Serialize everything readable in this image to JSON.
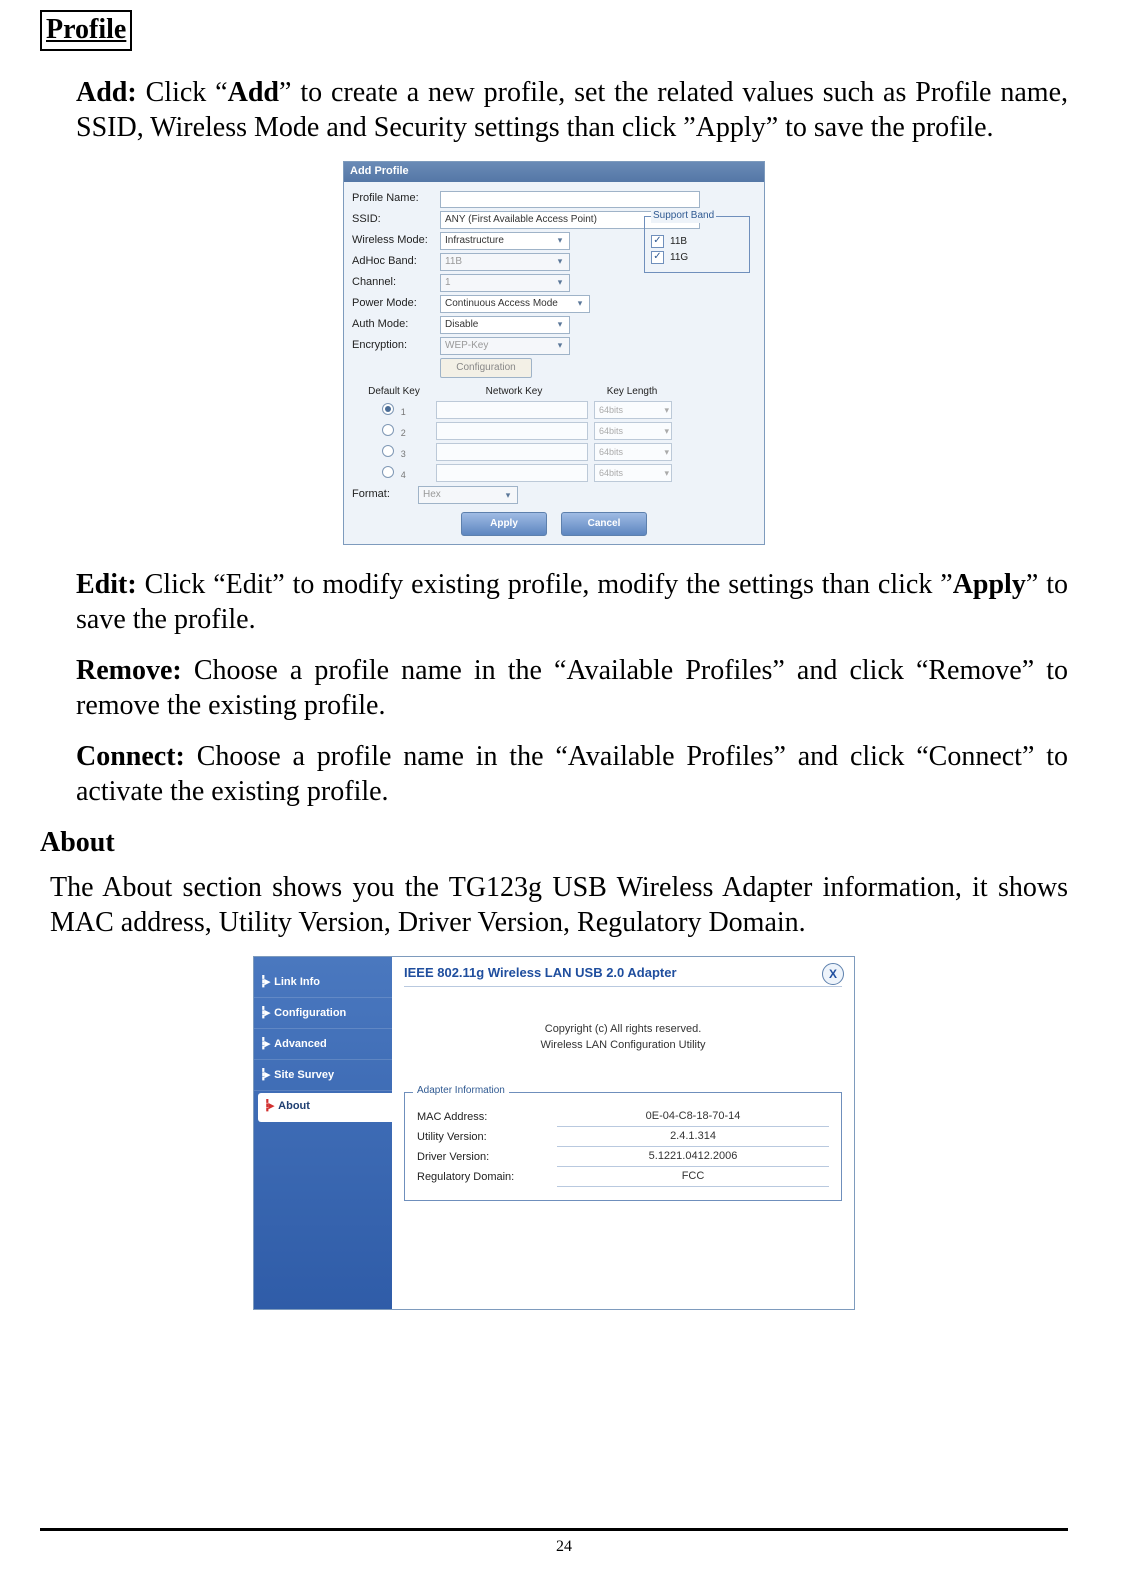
{
  "doc": {
    "section1_title": "Profile",
    "add_label": "Add:",
    "add_text_a": " Click “",
    "add_bold": "Add",
    "add_text_b": "” to create a new profile, set the related values such as Profile name, SSID, Wireless Mode and Security settings than click ”Apply” to save the profile.",
    "edit_label": "Edit:",
    "edit_text_a": " Click “Edit” to modify existing profile, modify the settings than click ”",
    "edit_bold": "Apply",
    "edit_text_b": "” to save the profile.",
    "remove_label": "Remove:",
    "remove_text": " Choose a profile name in the “Available Profiles” and click “Remove” to remove the existing profile.",
    "connect_label": "Connect:",
    "connect_text": " Choose a profile name in the “Available Profiles” and click “Connect” to activate the existing profile.",
    "section2_title": "About",
    "about_para": "The About section shows you the TG123g USB Wireless Adapter information, it shows MAC address, Utility Version, Driver Version, Regulatory Domain.",
    "page_number": "24"
  },
  "dialog": {
    "title": "Add Profile",
    "labels": {
      "profile_name": "Profile Name:",
      "ssid": "SSID:",
      "wireless_mode": "Wireless Mode:",
      "adhoc_band": "AdHoc Band:",
      "channel": "Channel:",
      "power_mode": "Power Mode:",
      "auth_mode": "Auth Mode:",
      "encryption": "Encryption:",
      "format": "Format:"
    },
    "values": {
      "ssid": "ANY (First Available Access Point)",
      "wireless_mode": "Infrastructure",
      "adhoc_band": "11B",
      "channel": "1",
      "power_mode": "Continuous Access Mode",
      "auth_mode": "Disable",
      "encryption": "WEP-Key",
      "format": "Hex"
    },
    "support_band": {
      "legend": "Support Band",
      "b": "11B",
      "g": "11G"
    },
    "cfg_btn": "Configuration",
    "key_headers": {
      "def": "Default Key",
      "net": "Network Key",
      "len": "Key Length"
    },
    "key_len_value": "64bits",
    "apply": "Apply",
    "cancel": "Cancel"
  },
  "about": {
    "sidebar": {
      "link_info": "Link Info",
      "configuration": "Configuration",
      "advanced": "Advanced",
      "site_survey": "Site Survey",
      "about": "About"
    },
    "title": "IEEE 802.11g Wireless LAN USB 2.0 Adapter",
    "copyright": "Copyright (c)  All rights reserved.",
    "prod_line": "Wireless LAN Configuration Utility",
    "adapter_legend": "Adapter Information",
    "rows": {
      "mac_l": "MAC Address:",
      "mac_v": "0E-04-C8-18-70-14",
      "util_l": "Utility Version:",
      "util_v": "2.4.1.314",
      "drv_l": "Driver Version:",
      "drv_v": "5.1221.0412.2006",
      "reg_l": "Regulatory Domain:",
      "reg_v": "FCC"
    },
    "close": "X"
  }
}
